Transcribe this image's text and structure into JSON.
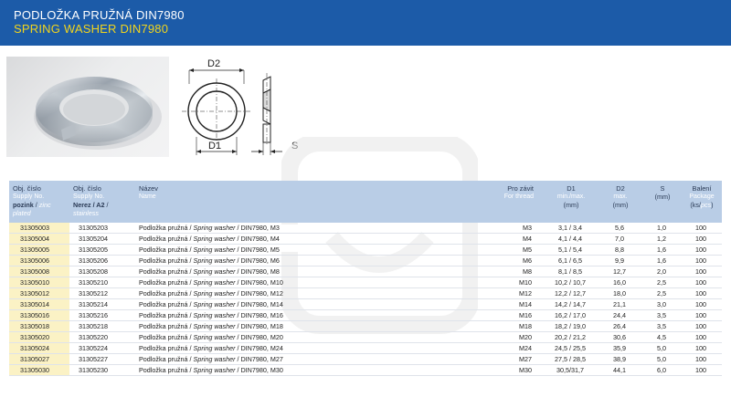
{
  "header": {
    "title_cz": "PODLOŽKA PRUŽNÁ DIN7980",
    "title_en": "SPRING WASHER DIN7980"
  },
  "drawing": {
    "label_d2": "D2",
    "label_d1": "D1",
    "label_s": "S"
  },
  "table": {
    "columns": {
      "code1": {
        "line1": "Obj. číslo",
        "line2": "Supply No.",
        "line3_bold": "pozink",
        "line3_sep": " / ",
        "line3_italic": "zinc plated"
      },
      "code2": {
        "line1": "Obj. číslo",
        "line2": "Supply No.",
        "line3_bold": "Nerez / A2",
        "line3_sep": " / ",
        "line3_italic": "stainless"
      },
      "name": {
        "line1": "Název",
        "line2": "Name"
      },
      "thread": {
        "line1": "Pro závit",
        "line2": "For thread"
      },
      "d1": {
        "line1": "D1",
        "line2": "min./max.",
        "line3": "(mm)"
      },
      "d2": {
        "line1": "D2",
        "line2": "max.",
        "line3": "(mm)"
      },
      "s": {
        "line1": "S",
        "line2": "",
        "line3": "(mm)"
      },
      "pack": {
        "line1": "Balení",
        "line2": "Package",
        "line3_a": "(ks/",
        "line3_b": "pcs",
        "line3_c": ")"
      }
    },
    "name_parts": {
      "prefix": "Podložka pružná / ",
      "italic": "Spring washer",
      "suffix": " / DIN7980, "
    },
    "rows": [
      {
        "code1": "31305003",
        "code2": "31305203",
        "size": "M3",
        "thread": "M3",
        "d1": "3,1 / 3,4",
        "d2": "5,6",
        "s": "1,0",
        "pack": "100"
      },
      {
        "code1": "31305004",
        "code2": "31305204",
        "size": "M4",
        "thread": "M4",
        "d1": "4,1 / 4,4",
        "d2": "7,0",
        "s": "1,2",
        "pack": "100"
      },
      {
        "code1": "31305005",
        "code2": "31305205",
        "size": "M5",
        "thread": "M5",
        "d1": "5,1 / 5,4",
        "d2": "8,8",
        "s": "1,6",
        "pack": "100"
      },
      {
        "code1": "31305006",
        "code2": "31305206",
        "size": "M6",
        "thread": "M6",
        "d1": "6,1 / 6,5",
        "d2": "9,9",
        "s": "1,6",
        "pack": "100"
      },
      {
        "code1": "31305008",
        "code2": "31305208",
        "size": "M8",
        "thread": "M8",
        "d1": "8,1 / 8,5",
        "d2": "12,7",
        "s": "2,0",
        "pack": "100"
      },
      {
        "code1": "31305010",
        "code2": "31305210",
        "size": "M10",
        "thread": "M10",
        "d1": "10,2 / 10,7",
        "d2": "16,0",
        "s": "2,5",
        "pack": "100"
      },
      {
        "code1": "31305012",
        "code2": "31305212",
        "size": "M12",
        "thread": "M12",
        "d1": "12,2 / 12,7",
        "d2": "18,0",
        "s": "2,5",
        "pack": "100"
      },
      {
        "code1": "31305014",
        "code2": "31305214",
        "size": "M14",
        "thread": "M14",
        "d1": "14,2 / 14,7",
        "d2": "21,1",
        "s": "3,0",
        "pack": "100"
      },
      {
        "code1": "31305016",
        "code2": "31305216",
        "size": "M16",
        "thread": "M16",
        "d1": "16,2 / 17,0",
        "d2": "24,4",
        "s": "3,5",
        "pack": "100"
      },
      {
        "code1": "31305018",
        "code2": "31305218",
        "size": "M18",
        "thread": "M18",
        "d1": "18,2 / 19,0",
        "d2": "26,4",
        "s": "3,5",
        "pack": "100"
      },
      {
        "code1": "31305020",
        "code2": "31305220",
        "size": "M20",
        "thread": "M20",
        "d1": "20,2 / 21,2",
        "d2": "30,6",
        "s": "4,5",
        "pack": "100"
      },
      {
        "code1": "31305024",
        "code2": "31305224",
        "size": "M24",
        "thread": "M24",
        "d1": "24,5 / 25,5",
        "d2": "35,9",
        "s": "5,0",
        "pack": "100"
      },
      {
        "code1": "31305027",
        "code2": "31305227",
        "size": "M27",
        "thread": "M27",
        "d1": "27,5 / 28,5",
        "d2": "38,9",
        "s": "5,0",
        "pack": "100"
      },
      {
        "code1": "31305030",
        "code2": "31305230",
        "size": "M30",
        "thread": "M30",
        "d1": "30,5/31,7",
        "d2": "44,1",
        "s": "6,0",
        "pack": "100"
      }
    ]
  }
}
